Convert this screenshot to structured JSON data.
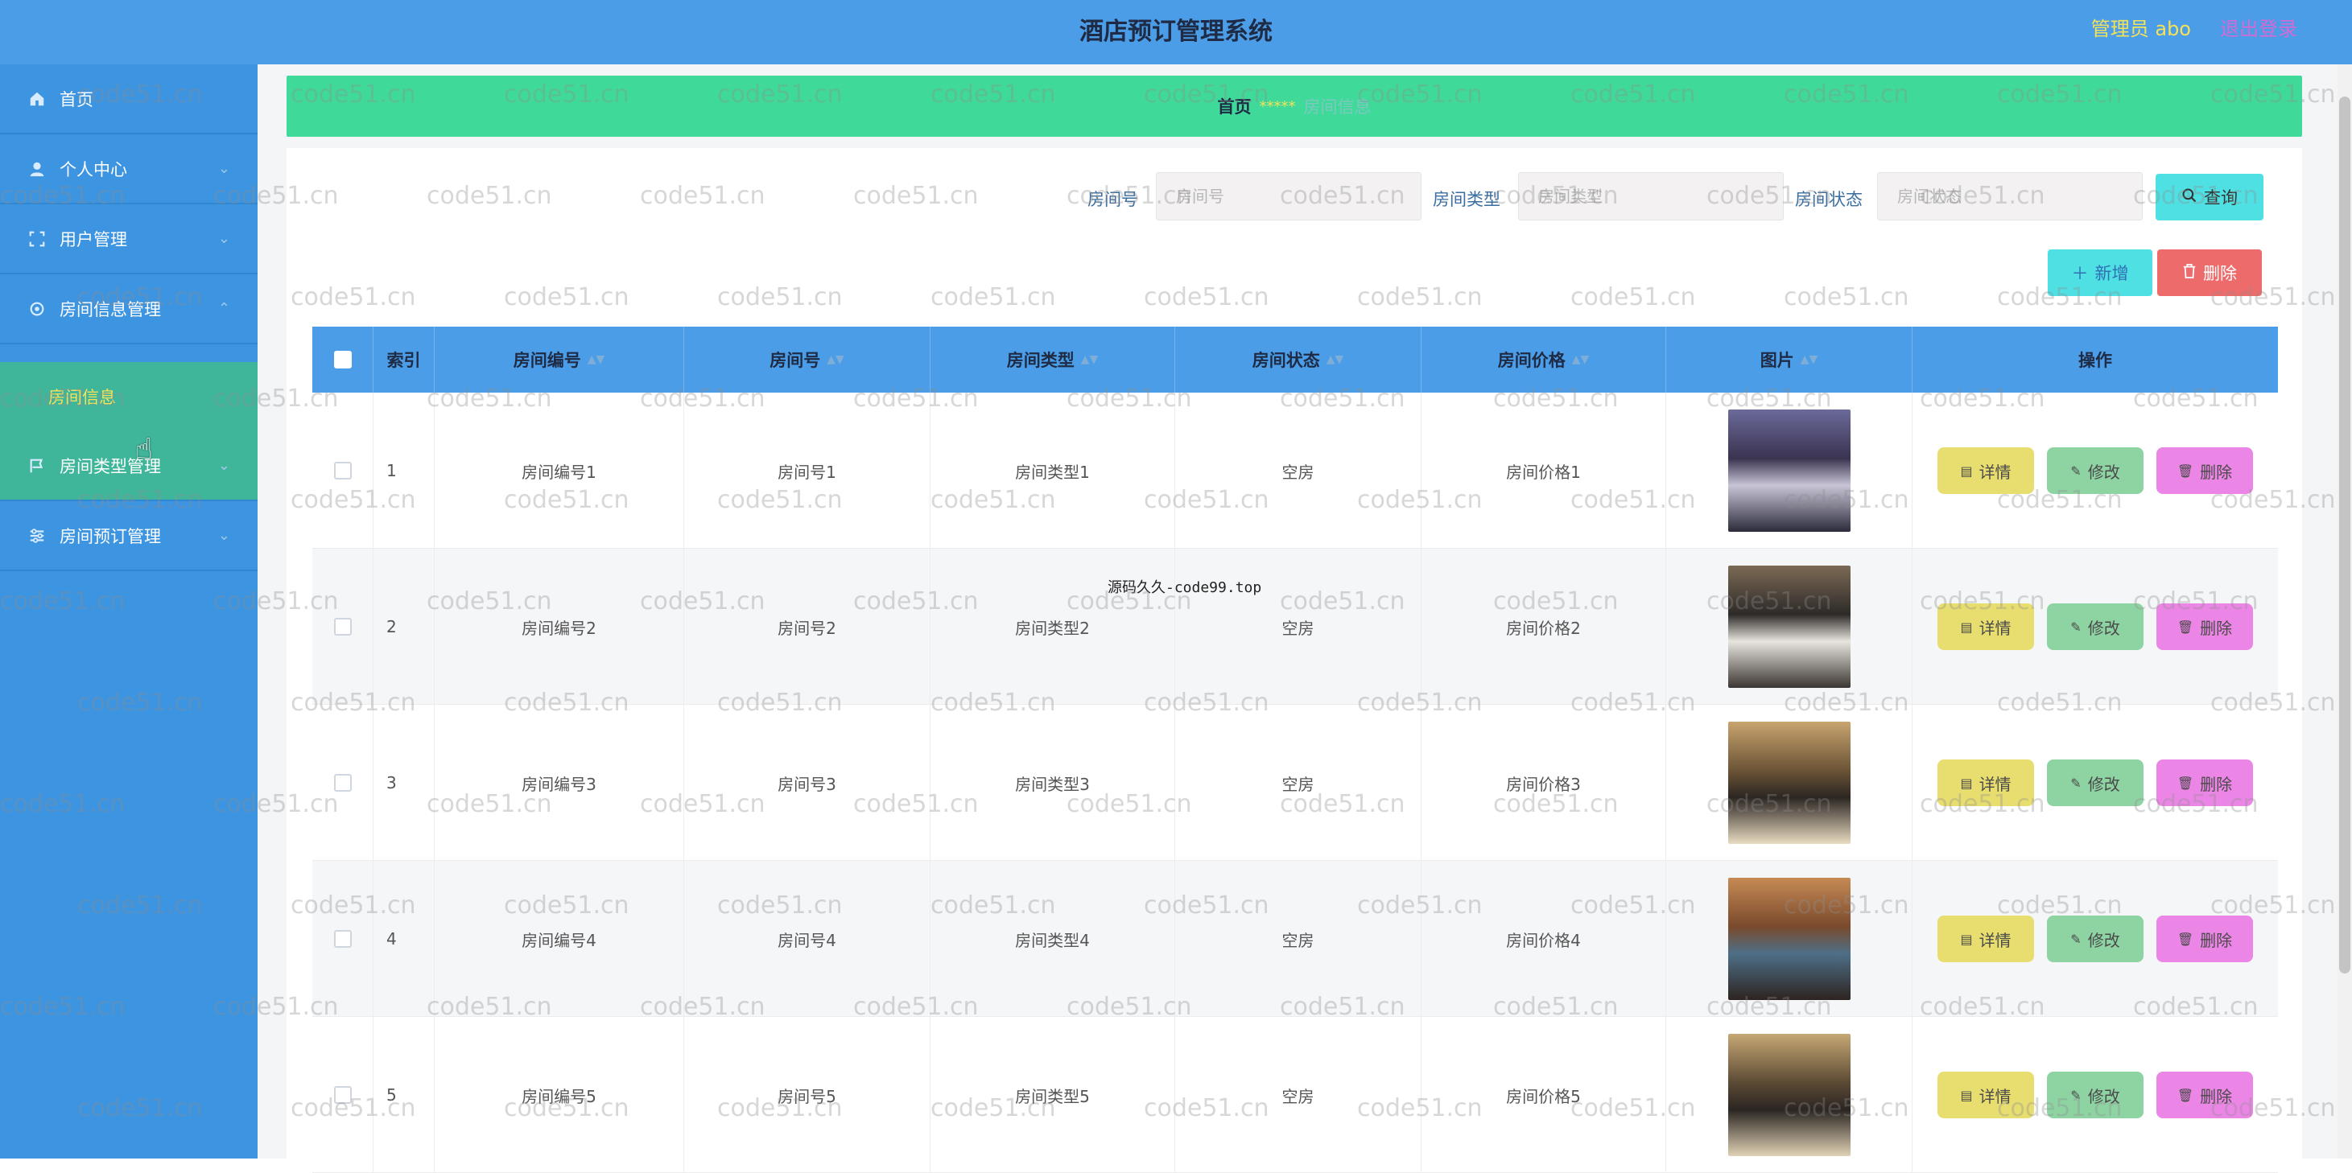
{
  "header": {
    "title": "酒店预订管理系统",
    "admin": "管理员 abo",
    "logout": "退出登录"
  },
  "sidebar": {
    "items": [
      {
        "label": "首页",
        "icon": "home-icon"
      },
      {
        "label": "个人中心",
        "icon": "user-icon"
      },
      {
        "label": "用户管理",
        "icon": "users-icon"
      },
      {
        "label": "房间信息管理",
        "icon": "settings-icon"
      },
      {
        "label": "房间信息",
        "icon": ""
      },
      {
        "label": "房间类型管理",
        "icon": "flag-icon"
      },
      {
        "label": "房间预订管理",
        "icon": "sliders-icon"
      }
    ]
  },
  "breadcrumb": {
    "home": "首页",
    "separator": "*****",
    "current": "房间信息"
  },
  "search": {
    "room_no_label": "房间号",
    "room_no_placeholder": "房间号",
    "room_type_label": "房间类型",
    "room_type_placeholder": "房间类型",
    "room_status_label": "房间状态",
    "room_status_placeholder": "房间状态",
    "query_button": "查询"
  },
  "toolbar": {
    "add_button": "新增",
    "delete_button": "删除"
  },
  "table": {
    "columns": [
      "索引",
      "房间编号",
      "房间号",
      "房间类型",
      "房间状态",
      "房间价格",
      "图片",
      "操作"
    ],
    "rows": [
      {
        "index": "1",
        "code": "房间编号1",
        "no": "房间号1",
        "type": "房间类型1",
        "status": "空房",
        "price": "房间价格1"
      },
      {
        "index": "2",
        "code": "房间编号2",
        "no": "房间号2",
        "type": "房间类型2",
        "status": "空房",
        "price": "房间价格2"
      },
      {
        "index": "3",
        "code": "房间编号3",
        "no": "房间号3",
        "type": "房间类型3",
        "status": "空房",
        "price": "房间价格3"
      },
      {
        "index": "4",
        "code": "房间编号4",
        "no": "房间号4",
        "type": "房间类型4",
        "status": "空房",
        "price": "房间价格4"
      },
      {
        "index": "5",
        "code": "房间编号5",
        "no": "房间号5",
        "type": "房间类型5",
        "status": "空房",
        "price": "房间价格5"
      }
    ],
    "actions": {
      "detail": "详情",
      "edit": "修改",
      "delete": "删除"
    }
  },
  "watermark": {
    "repeat": "code51.cn",
    "center": "源码久久-code99.top"
  },
  "colors": {
    "topbar": "#4a9de6",
    "sidebar": "#3d94e0",
    "active_menu": "#3fb69a",
    "breadcrumb_bg": "#3fda9a",
    "detail_btn": "#e8de70",
    "edit_btn": "#8ed4a3",
    "delete_btn": "#ec86e6"
  }
}
